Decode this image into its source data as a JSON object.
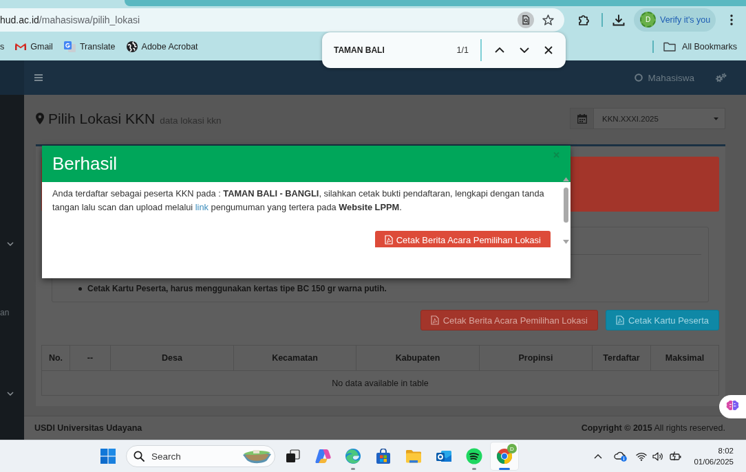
{
  "browser": {
    "address": {
      "host": "hud.ac.id",
      "path": "/mahasiswa/pilih_lokasi"
    },
    "profile": {
      "initial": "D",
      "label": "Verify it's you"
    },
    "bookmarks": [
      {
        "kind": "plain",
        "label": "s"
      },
      {
        "kind": "mail",
        "label": "Gmail"
      },
      {
        "kind": "translate",
        "label": "Translate"
      },
      {
        "kind": "globe",
        "label": "Adobe Acrobat"
      }
    ],
    "all_bookmarks": "All Bookmarks",
    "find_bar": {
      "query": "TAMAN BALI",
      "count": "1/1"
    }
  },
  "header": {
    "user": "Mahasiswa"
  },
  "sidebar": {
    "items": [
      {
        "kind": "chevron"
      },
      {
        "kind": "text",
        "label": "an"
      },
      {
        "kind": "chevron"
      }
    ]
  },
  "page": {
    "title": "Pilih Lokasi KKN",
    "subtitle": "data lokasi kkn",
    "period_select": {
      "value": "KKN.XXXI.2025"
    }
  },
  "notes": [
    "Cetak Kartu Peserta, harus menggunakan kertas tipe BC 150 gr warna putih."
  ],
  "actions": [
    {
      "kind": "danger",
      "label": "Cetak Berita Acara Pemilihan Lokasi"
    },
    {
      "kind": "info",
      "label": "Cetak Kartu Peserta"
    }
  ],
  "table": {
    "columns": [
      "No.",
      "--",
      "Desa",
      "Kecamatan",
      "Kabupaten",
      "Propinsi",
      "Terdaftar",
      "Maksimal"
    ],
    "empty_message": "No data available in table"
  },
  "footer": {
    "left": "USDI Universitas Udayana",
    "right": "**Copyright © 2015** All rights reserved."
  },
  "modal": {
    "title": "Berhasil",
    "message": {
      "before": "Anda terdaftar sebagai peserta KKN pada : **TAMAN BALI - BANGLI**, silahkan cetak bukti pendaftaran, lengkapi dengan tanda tangan lalu scan dan upload melalui",
      "link": "link",
      "after": "pengumuman yang tertera pada **Website LPPM**."
    },
    "button": "Cetak Berita Acara Pemilihan Lokasi"
  },
  "taskbar": {
    "search_placeholder": "Search",
    "apps": [
      {
        "kind": "task-view",
        "running": false,
        "active": false
      },
      {
        "kind": "copilot",
        "running": false,
        "active": false
      },
      {
        "kind": "edge",
        "running": true,
        "active": false
      },
      {
        "kind": "store",
        "running": false,
        "active": false
      },
      {
        "kind": "explorer",
        "running": false,
        "active": false
      },
      {
        "kind": "outlook",
        "running": false,
        "active": false
      },
      {
        "kind": "spotify",
        "running": true,
        "active": false
      },
      {
        "kind": "chrome",
        "running": true,
        "active": true,
        "badge": "D"
      }
    ],
    "time": "8:02",
    "date": "01/06/2025"
  }
}
